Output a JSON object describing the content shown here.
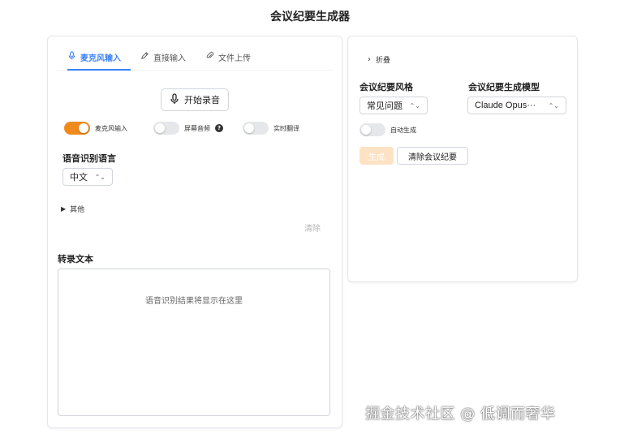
{
  "app": {
    "title": "会议纪要生成器"
  },
  "left": {
    "tabs": [
      {
        "label": "麦克风输入",
        "icon": "microphone-icon",
        "active": true
      },
      {
        "label": "直接输入",
        "icon": "pencil-icon",
        "active": false
      },
      {
        "label": "文件上传",
        "icon": "paperclip-icon",
        "active": false
      }
    ],
    "record_button": "开始录音",
    "toggles": {
      "mic": {
        "label": "麦克风输入",
        "on": true
      },
      "screen": {
        "label": "屏幕音频",
        "on": false
      },
      "translate": {
        "label": "实时翻译",
        "on": false
      }
    },
    "help_glyph": "?",
    "language": {
      "label": "语音识别语言",
      "value": "中文"
    },
    "other_label": "其他",
    "clear_label": "清除",
    "transcript": {
      "label": "转录文本",
      "placeholder": "语音识别结果将显示在这里"
    }
  },
  "right": {
    "fold_label": "折叠",
    "style": {
      "label": "会议纪要风格",
      "value": "常见问题"
    },
    "model": {
      "label": "会议纪要生成模型",
      "value": "Claude Opus···"
    },
    "auto_generate": {
      "label": "自动生成",
      "on": false
    },
    "generate_button": "生成",
    "clear_minutes_button": "清除会议纪要"
  },
  "watermark": "掘金技术社区 @ 低调而奢华",
  "colors": {
    "accent_blue": "#3b82f6",
    "accent_orange": "#f08a1c",
    "disabled_orange": "#fde2c4"
  }
}
